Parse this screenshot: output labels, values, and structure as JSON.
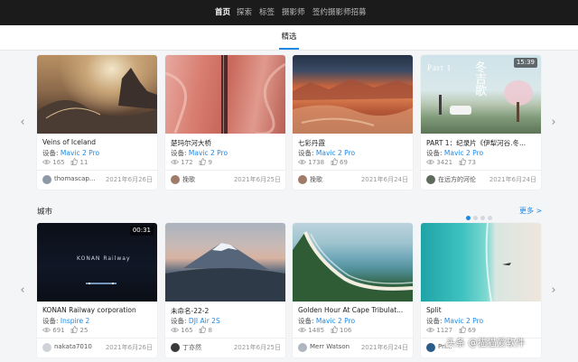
{
  "nav": {
    "items": [
      "首页",
      "探索",
      "标签",
      "摄影师",
      "签约摄影师招募"
    ]
  },
  "subnav": {
    "tab": "精选"
  },
  "device_prefix": "设备: ",
  "featured": [
    {
      "title": "Veins of Iceland",
      "model": "Mavic 2 Pro",
      "views": "165",
      "likes": "11",
      "author": "thomascap...",
      "date": "2021年6月26日"
    },
    {
      "title": "楚玛尔河大桥",
      "model": "Mavic 2 Pro",
      "views": "172",
      "likes": "9",
      "author": "挽歌",
      "date": "2021年6月25日"
    },
    {
      "title": "七彩丹霞",
      "model": "Mavic 2 Pro",
      "views": "1738",
      "likes": "69",
      "author": "挽歌",
      "date": "2021年6月24日"
    },
    {
      "title": "PART 1：纪录片《伊犁河谷.冬...",
      "model": "Mavic 2 Pro",
      "views": "3421",
      "likes": "73",
      "author": "在远方的河伦",
      "date": "2021年6月24日",
      "duration": "15:39",
      "overlay_part": "Part 1",
      "overlay_cn": "冬\n吉\n歌"
    }
  ],
  "city": {
    "title": "城市",
    "more": "更多 >",
    "cards": [
      {
        "title": "KONAN Railway corporation",
        "model": "Inspire 2",
        "views": "691",
        "likes": "25",
        "author": "nakata7010",
        "date": "2021年6月26日",
        "duration": "00:31",
        "overlay": "KONAN Railway"
      },
      {
        "title": "未命名-22-2",
        "model": "DJI Air 2S",
        "views": "165",
        "likes": "8",
        "author": "丁亦然",
        "date": "2021年6月25日"
      },
      {
        "title": "Golden Hour At Cape Tribulat...",
        "model": "Mavic 2 Pro",
        "views": "1485",
        "likes": "106",
        "author": "Merr Watson",
        "date": "2021年6月24日"
      },
      {
        "title": "Split",
        "model": "Mavic 2 Pro",
        "views": "1127",
        "likes": "69",
        "author": "Pri...",
        "date": ""
      }
    ]
  },
  "watermark": "头条 @猫猫爱软件"
}
